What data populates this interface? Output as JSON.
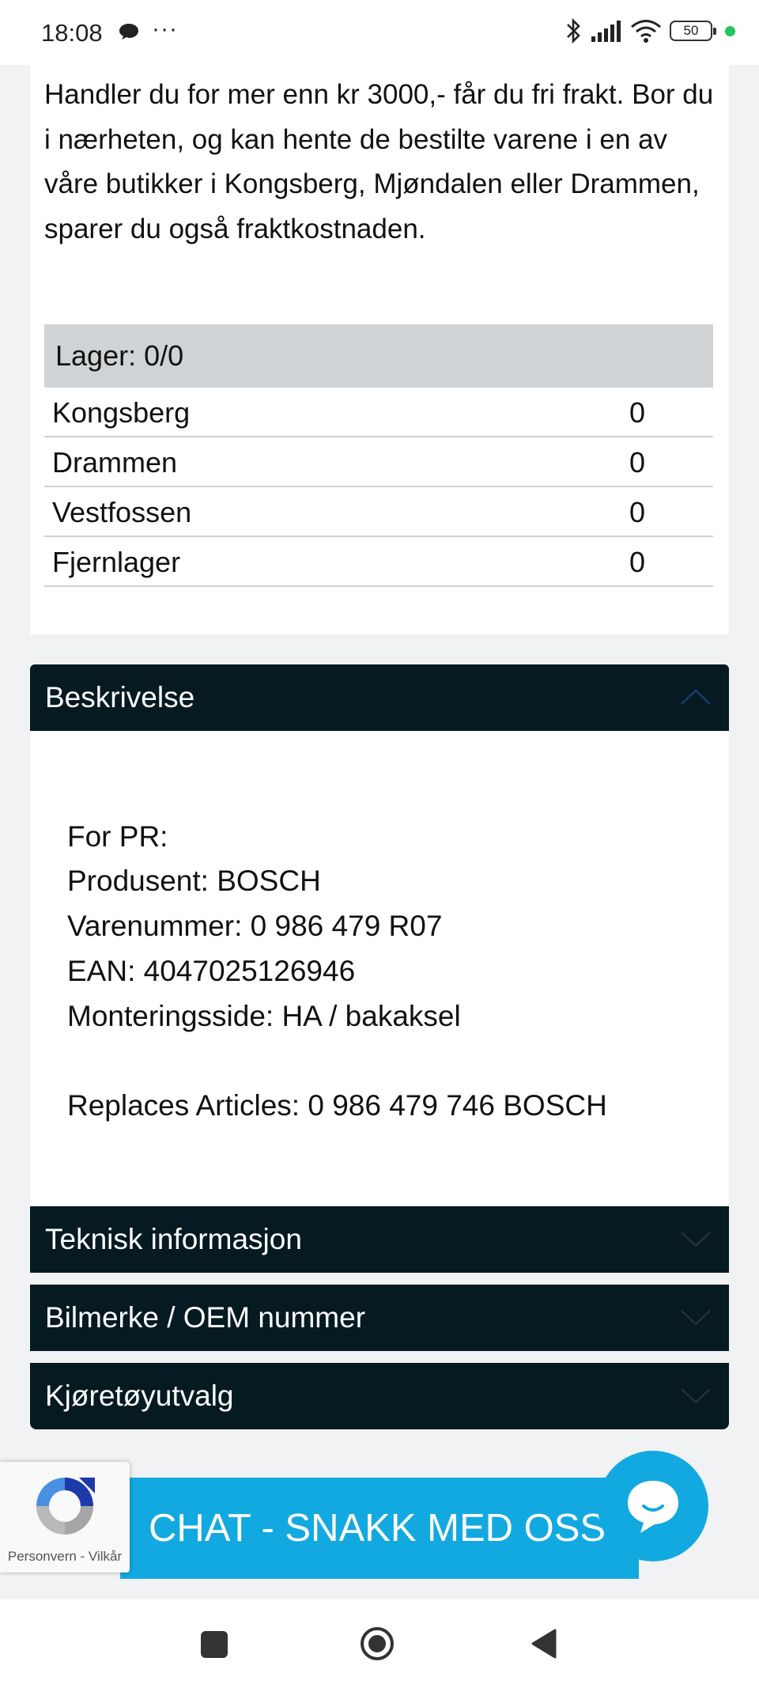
{
  "status_bar": {
    "time": "18:08",
    "dots": "···",
    "battery": "50"
  },
  "intro_text": "Handler du for mer enn kr 3000,- får du fri frakt. Bor du i nærheten, og kan hente de bestilte varene i en av våre butikker i Kongsberg, Mjøndalen eller Drammen, sparer du også fraktkostnaden.",
  "stock": {
    "header": "Lager: 0/0",
    "rows": [
      {
        "name": "Kongsberg",
        "qty": "0"
      },
      {
        "name": "Drammen",
        "qty": "0"
      },
      {
        "name": "Vestfossen",
        "qty": "0"
      },
      {
        "name": "Fjernlager",
        "qty": "0"
      }
    ]
  },
  "accordion": {
    "description_title": "Beskrivelse",
    "description_lines": [
      "For PR:",
      "Produsent: BOSCH",
      "Varenummer: 0 986 479 R07",
      "EAN: 4047025126946",
      "Monteringsside: HA / bakaksel",
      "Replaces Articles: 0 986 479 746 BOSCH"
    ],
    "technical_title": "Teknisk informasjon",
    "oem_title": "Bilmerke / OEM nummer",
    "vehicle_title": "Kjøretøyutvalg"
  },
  "recaptcha": {
    "label": "Personvern - Vilkår"
  },
  "chat": {
    "label": "CHAT - SNAKK MED OSS"
  },
  "colors": {
    "accordion_bg": "#061a22",
    "chat_blue": "#12a9e0",
    "stock_header_bg": "#d0d3d6"
  }
}
